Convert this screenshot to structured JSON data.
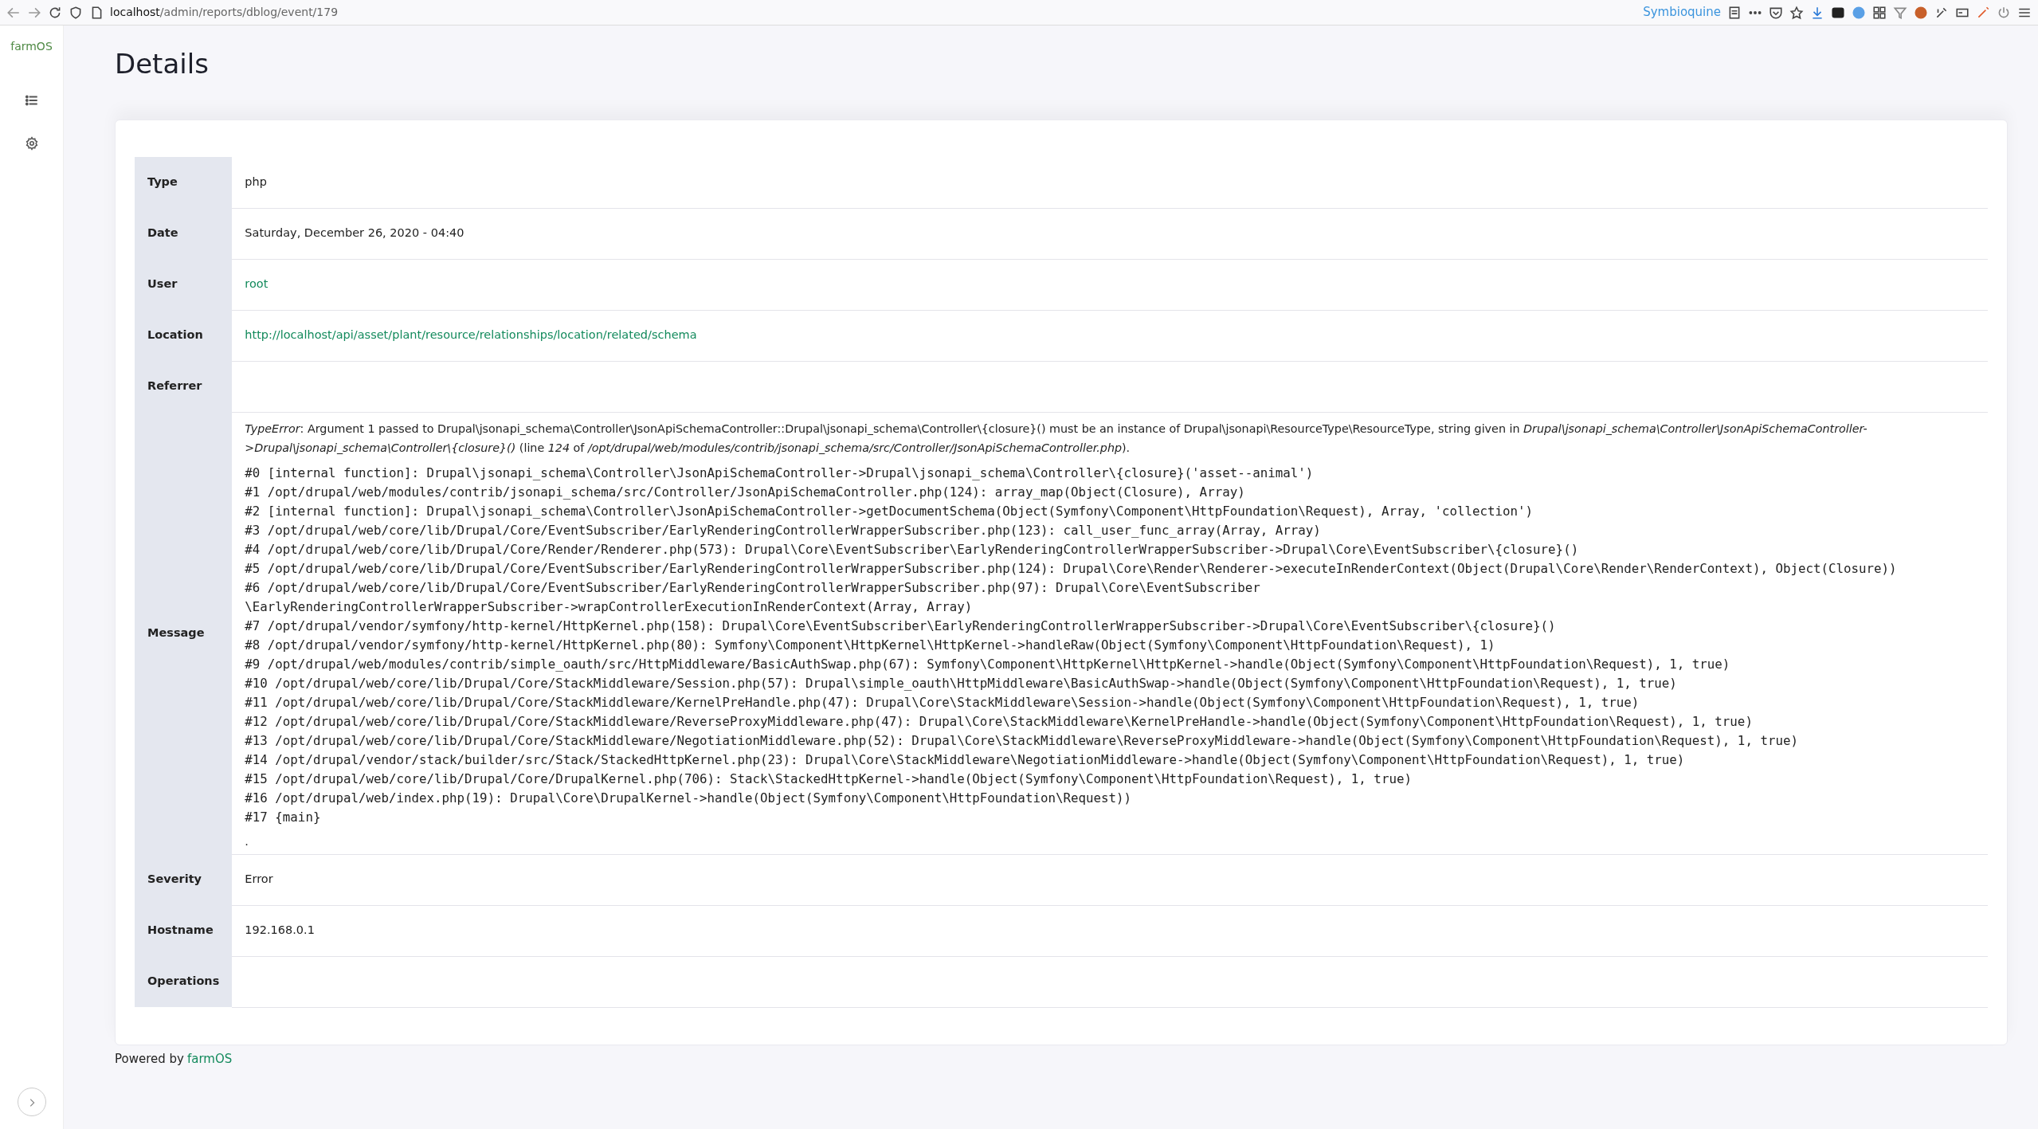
{
  "browser": {
    "url_host": "localhost",
    "url_path": "/admin/reports/dblog/event/179",
    "profile": "Symbioquine"
  },
  "sidebar": {
    "logo": "farmOS"
  },
  "title": "Details",
  "rows": [
    {
      "label": "Type",
      "kind": "text",
      "value": "php"
    },
    {
      "label": "Date",
      "kind": "text",
      "value": "Saturday, December 26, 2020 - 04:40"
    },
    {
      "label": "User",
      "kind": "link",
      "value": "root"
    },
    {
      "label": "Location",
      "kind": "link",
      "value": "http://localhost/api/asset/plant/resource/relationships/location/related/schema"
    },
    {
      "label": "Referrer",
      "kind": "text",
      "value": ""
    },
    {
      "label": "Message",
      "kind": "message",
      "summary": "*TypeError*: Argument 1 passed to Drupal\\jsonapi_schema\\Controller\\JsonApiSchemaController::Drupal\\jsonapi_schema\\Controller\\{closure}() must be an instance of Drupal\\jsonapi\\ResourceType\\ResourceType, string given in *Drupal\\jsonapi_schema\\Controller\\JsonApiSchemaController->Drupal\\jsonapi_schema\\Controller\\{closure}()* (line *124* of */opt/drupal/web/modules/contrib/jsonapi_schema/src/Controller/JsonApiSchemaController.php*).",
      "trace": [
        "#0 [internal function]: Drupal\\jsonapi_schema\\Controller\\JsonApiSchemaController->Drupal\\jsonapi_schema\\Controller\\{closure}('asset--animal')",
        "#1 /opt/drupal/web/modules/contrib/jsonapi_schema/src/Controller/JsonApiSchemaController.php(124): array_map(Object(Closure), Array)",
        "#2 [internal function]: Drupal\\jsonapi_schema\\Controller\\JsonApiSchemaController->getDocumentSchema(Object(Symfony\\Component\\HttpFoundation\\Request), Array, 'collection')",
        "#3 /opt/drupal/web/core/lib/Drupal/Core/EventSubscriber/EarlyRenderingControllerWrapperSubscriber.php(123): call_user_func_array(Array, Array)",
        "#4 /opt/drupal/web/core/lib/Drupal/Core/Render/Renderer.php(573): Drupal\\Core\\EventSubscriber\\EarlyRenderingControllerWrapperSubscriber->Drupal\\Core\\EventSubscriber\\{closure}()",
        "#5 /opt/drupal/web/core/lib/Drupal/Core/EventSubscriber/EarlyRenderingControllerWrapperSubscriber.php(124): Drupal\\Core\\Render\\Renderer->executeInRenderContext(Object(Drupal\\Core\\Render\\RenderContext), Object(Closure))",
        "#6 /opt/drupal/web/core/lib/Drupal/Core/EventSubscriber/EarlyRenderingControllerWrapperSubscriber.php(97): Drupal\\Core\\EventSubscriber\n\\EarlyRenderingControllerWrapperSubscriber->wrapControllerExecutionInRenderContext(Array, Array)",
        "#7 /opt/drupal/vendor/symfony/http-kernel/HttpKernel.php(158): Drupal\\Core\\EventSubscriber\\EarlyRenderingControllerWrapperSubscriber->Drupal\\Core\\EventSubscriber\\{closure}()",
        "#8 /opt/drupal/vendor/symfony/http-kernel/HttpKernel.php(80): Symfony\\Component\\HttpKernel\\HttpKernel->handleRaw(Object(Symfony\\Component\\HttpFoundation\\Request), 1)",
        "#9 /opt/drupal/web/modules/contrib/simple_oauth/src/HttpMiddleware/BasicAuthSwap.php(67): Symfony\\Component\\HttpKernel\\HttpKernel->handle(Object(Symfony\\Component\\HttpFoundation\\Request), 1, true)",
        "#10 /opt/drupal/web/core/lib/Drupal/Core/StackMiddleware/Session.php(57): Drupal\\simple_oauth\\HttpMiddleware\\BasicAuthSwap->handle(Object(Symfony\\Component\\HttpFoundation\\Request), 1, true)",
        "#11 /opt/drupal/web/core/lib/Drupal/Core/StackMiddleware/KernelPreHandle.php(47): Drupal\\Core\\StackMiddleware\\Session->handle(Object(Symfony\\Component\\HttpFoundation\\Request), 1, true)",
        "#12 /opt/drupal/web/core/lib/Drupal/Core/StackMiddleware/ReverseProxyMiddleware.php(47): Drupal\\Core\\StackMiddleware\\KernelPreHandle->handle(Object(Symfony\\Component\\HttpFoundation\\Request), 1, true)",
        "#13 /opt/drupal/web/core/lib/Drupal/Core/StackMiddleware/NegotiationMiddleware.php(52): Drupal\\Core\\StackMiddleware\\ReverseProxyMiddleware->handle(Object(Symfony\\Component\\HttpFoundation\\Request), 1, true)",
        "#14 /opt/drupal/vendor/stack/builder/src/Stack/StackedHttpKernel.php(23): Drupal\\Core\\StackMiddleware\\NegotiationMiddleware->handle(Object(Symfony\\Component\\HttpFoundation\\Request), 1, true)",
        "#15 /opt/drupal/web/core/lib/Drupal/Core/DrupalKernel.php(706): Stack\\StackedHttpKernel->handle(Object(Symfony\\Component\\HttpFoundation\\Request), 1, true)",
        "#16 /opt/drupal/web/index.php(19): Drupal\\Core\\DrupalKernel->handle(Object(Symfony\\Component\\HttpFoundation\\Request))",
        "#17 {main}"
      ],
      "tail": "."
    },
    {
      "label": "Severity",
      "kind": "text",
      "value": "Error"
    },
    {
      "label": "Hostname",
      "kind": "text",
      "value": "192.168.0.1"
    },
    {
      "label": "Operations",
      "kind": "text",
      "value": ""
    }
  ],
  "footer": {
    "text": "Powered by",
    "link": "farmOS"
  }
}
